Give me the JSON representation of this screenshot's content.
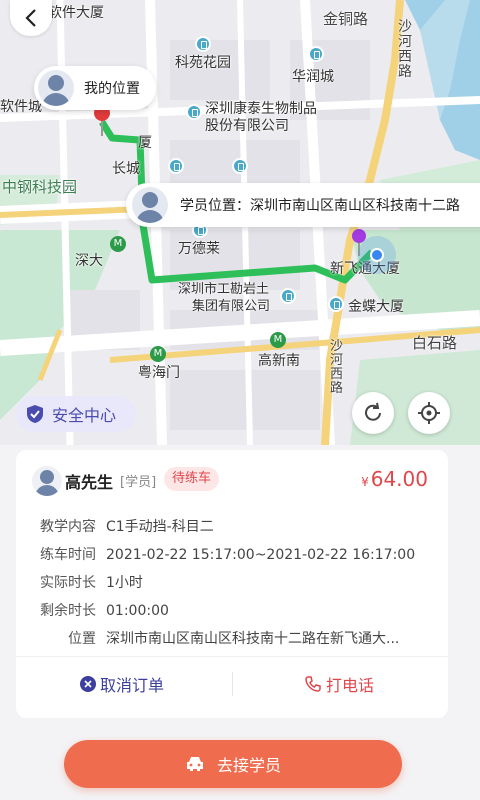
{
  "map": {
    "labels": {
      "ruanjian_dasha": "软件大厦",
      "ruanjian_cheng": "软件城",
      "jintong_road": "金铜路",
      "shahe_west_road_top": "沙河西路",
      "keyuan_huayuan": "科苑花园",
      "huarun_cheng": "华润城",
      "kangtai_line1": "深圳康泰生物制品",
      "kangtai_line2": "股份有限公司",
      "changcheng": "长城",
      "dasha_partial": "厦",
      "zhonggang": "中钢科技园",
      "wandelai": "万德莱",
      "shenda": "深大",
      "xinfeitong": "新飞通大厦",
      "gongkan_line1": "深圳市工勘岩土",
      "gongkan_line2": "集团有限公司",
      "jindie": "金蝶大厦",
      "baishi_road": "白石路",
      "shahe_west_road_bottom": "沙河西路",
      "yuehaimen": "粤海门",
      "gaoxinnan": "高新南",
      "metro_glyph": "M"
    },
    "my_location_label": "我的位置",
    "student_location_label": "学员位置：深圳市南山区南山区科技南十二路",
    "safety_center_label": "安全中心",
    "route_color": "#2fbf5a",
    "pin_color": "#e23b3b"
  },
  "order": {
    "name": "高先生",
    "role": "[学员]",
    "status": "待练车",
    "currency": "¥",
    "price": "64.00",
    "rows": [
      {
        "label": "教学内容",
        "value": "C1手动挡-科目二"
      },
      {
        "label": "练车时间",
        "value": "2021-02-22 15:17:00~2021-02-22 16:17:00"
      },
      {
        "label": "实际时长",
        "value": "1小时"
      },
      {
        "label": "剩余时长",
        "value": "01:00:00"
      },
      {
        "label": "位置",
        "value": "深圳市南山区南山区科技南十二路在新飞通大..."
      }
    ],
    "cancel_label": "取消订单",
    "call_label": "打电话",
    "accent_color": "#e0474c",
    "cancel_color": "#3d3f9e"
  },
  "cta": {
    "label": "去接学员",
    "color": "#ef6c4e"
  }
}
